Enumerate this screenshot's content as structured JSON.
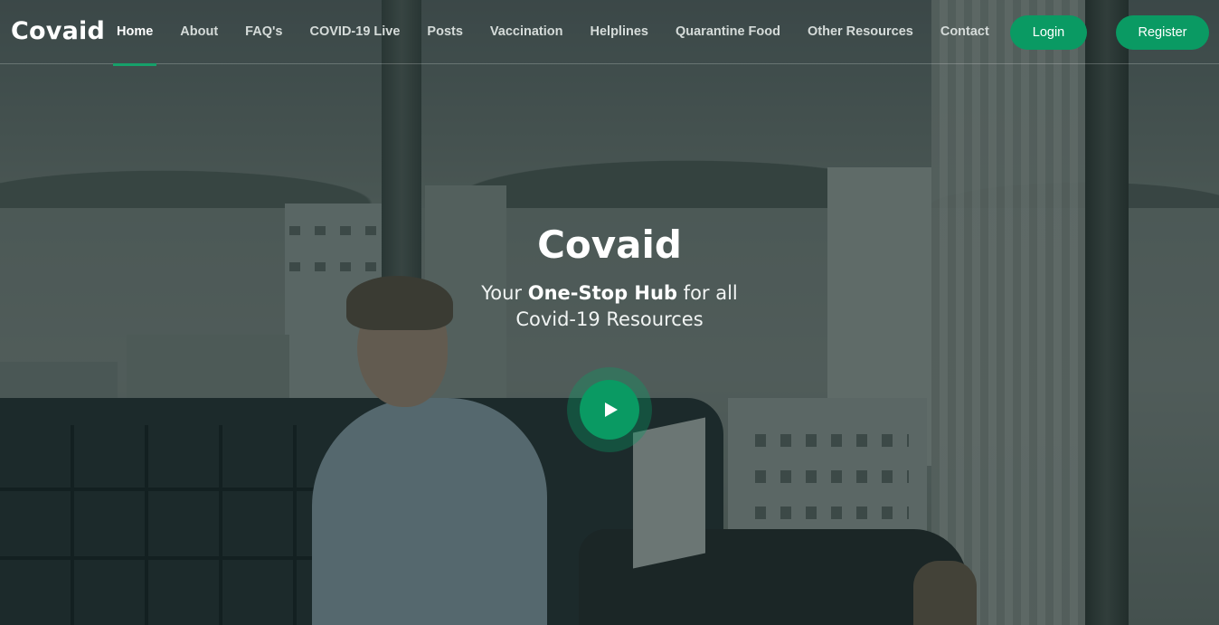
{
  "header": {
    "logo": "Covaid",
    "nav": [
      {
        "label": "Home",
        "active": true
      },
      {
        "label": "About",
        "active": false
      },
      {
        "label": "FAQ's",
        "active": false
      },
      {
        "label": "COVID-19 Live",
        "active": false
      },
      {
        "label": "Posts",
        "active": false
      },
      {
        "label": "Vaccination",
        "active": false
      },
      {
        "label": "Helplines",
        "active": false
      },
      {
        "label": "Quarantine Food",
        "active": false
      },
      {
        "label": "Other Resources",
        "active": false
      },
      {
        "label": "Contact",
        "active": false
      }
    ],
    "login_label": "Login",
    "register_label": "Register"
  },
  "hero": {
    "title": "Covaid",
    "subtitle_pre": "Your ",
    "subtitle_bold": "One-Stop Hub",
    "subtitle_post": " for all Covid-19 Resources",
    "play_icon": "play-icon"
  },
  "colors": {
    "accent": "#0a9a63",
    "active_underline": "#16a06a",
    "text": "#ffffff"
  }
}
